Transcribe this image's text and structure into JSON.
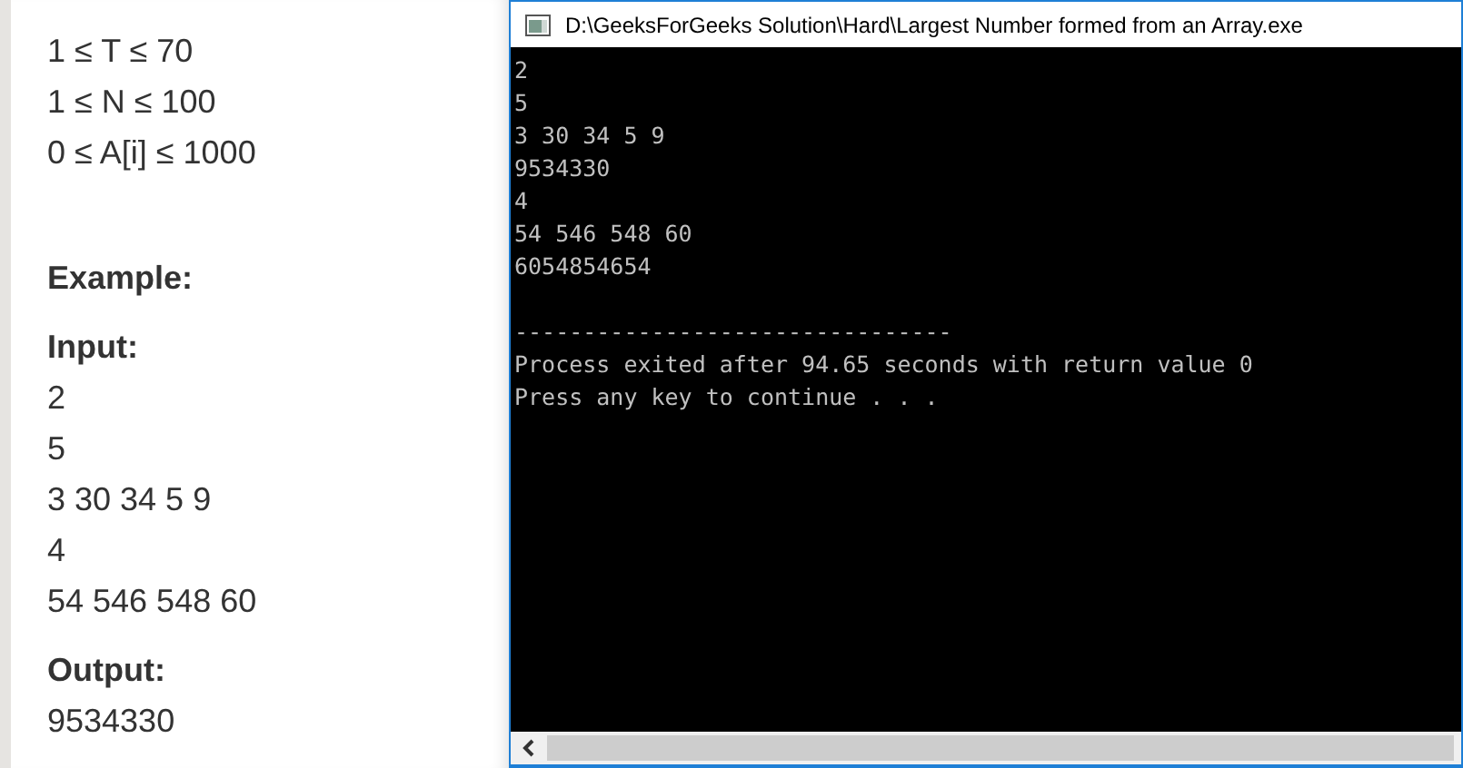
{
  "problem": {
    "constraints": [
      "1 ≤ T ≤ 70",
      "1 ≤ N ≤ 100",
      "0 ≤ A[i] ≤ 1000"
    ],
    "example_heading": "Example:",
    "input_label": "Input:",
    "input_lines": [
      "2",
      "5",
      "3 30 34 5 9",
      "4",
      "54 546 548 60"
    ],
    "output_label": "Output:",
    "output_lines": [
      "9534330"
    ]
  },
  "console": {
    "title": "D:\\GeeksForGeeks Solution\\Hard\\Largest Number formed from an Array.exe",
    "output_lines": [
      "2",
      "5",
      "3 30 34 5 9",
      "9534330",
      "4",
      "54 546 548 60",
      "6054854654"
    ],
    "footer_lines": [
      "--------------------------------",
      "Process exited after 94.65 seconds with return value 0",
      "Press any key to continue . . ."
    ]
  }
}
